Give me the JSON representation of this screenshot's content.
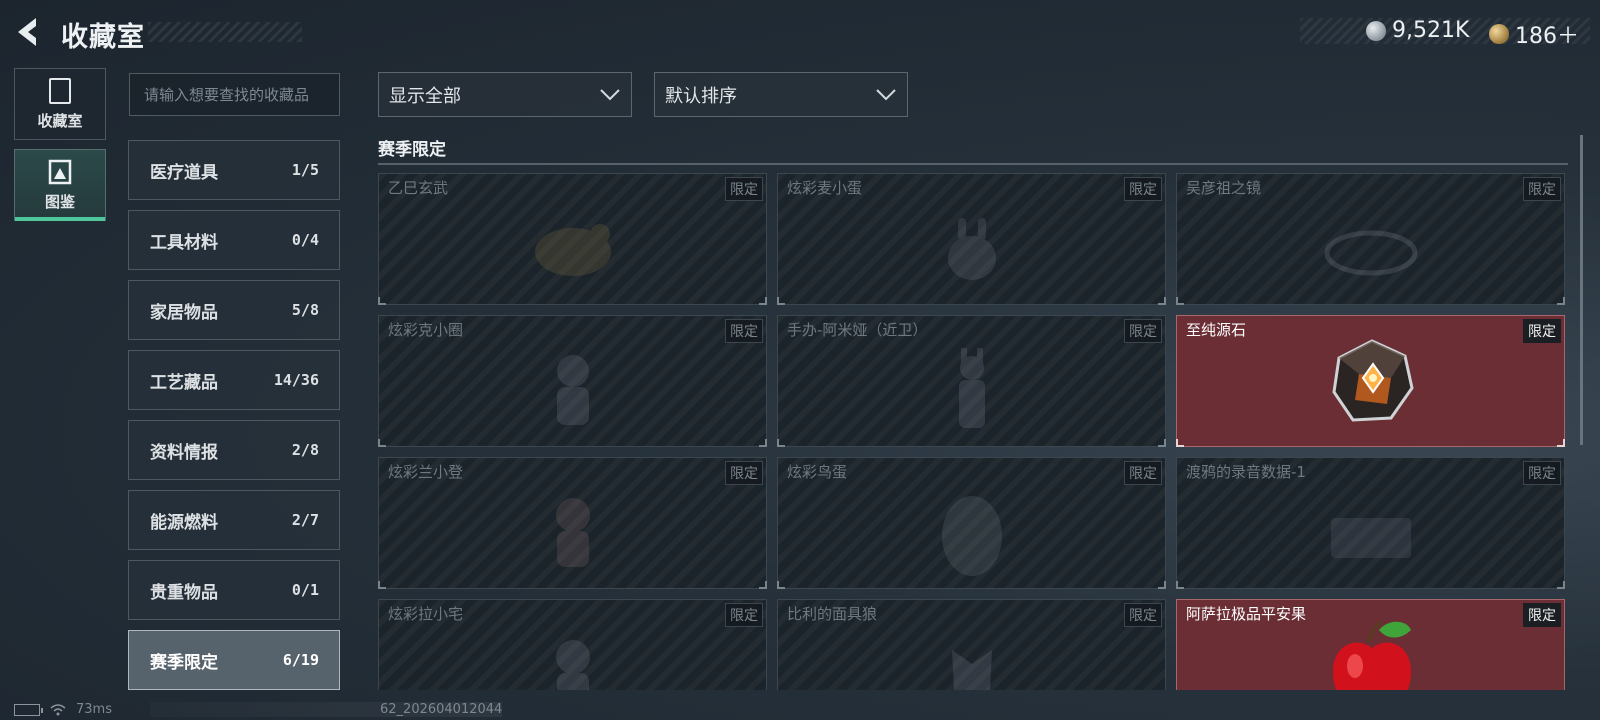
{
  "header": {
    "title": "收藏室"
  },
  "currency": {
    "silver": "9,521K",
    "gold": "186＋"
  },
  "rail": [
    {
      "label": "收藏室",
      "icon": "trophy-case-icon"
    },
    {
      "label": "图鉴",
      "icon": "codex-icon"
    }
  ],
  "search": {
    "placeholder": "请输入想要查找的收藏品"
  },
  "categories": [
    {
      "name": "医疗道具",
      "count": "1/5"
    },
    {
      "name": "工具材料",
      "count": "0/4"
    },
    {
      "name": "家居物品",
      "count": "5/8"
    },
    {
      "name": "工艺藏品",
      "count": "14/36"
    },
    {
      "name": "资料情报",
      "count": "2/8"
    },
    {
      "name": "能源燃料",
      "count": "2/7"
    },
    {
      "name": "贵重物品",
      "count": "0/1"
    },
    {
      "name": "赛季限定",
      "count": "6/19"
    }
  ],
  "filters": {
    "show": "显示全部",
    "sort": "默认排序"
  },
  "section": {
    "title": "赛季限定"
  },
  "items": [
    {
      "name": "乙巳玄武",
      "tag": "限定",
      "owned": false
    },
    {
      "name": "炫彩麦小蛋",
      "tag": "限定",
      "owned": false
    },
    {
      "name": "吴彦祖之镜",
      "tag": "限定",
      "owned": false
    },
    {
      "name": "炫彩克小圈",
      "tag": "限定",
      "owned": false
    },
    {
      "name": "手办-阿米娅（近卫）",
      "tag": "限定",
      "owned": false
    },
    {
      "name": "至纯源石",
      "tag": "限定",
      "owned": true
    },
    {
      "name": "炫彩兰小登",
      "tag": "限定",
      "owned": false
    },
    {
      "name": "炫彩鸟蛋",
      "tag": "限定",
      "owned": false
    },
    {
      "name": "渡鸦的录音数据-1",
      "tag": "限定",
      "owned": false
    },
    {
      "name": "炫彩拉小宅",
      "tag": "限定",
      "owned": false
    },
    {
      "name": "比利的面具狼",
      "tag": "限定",
      "owned": false
    },
    {
      "name": "阿萨拉极品平安果",
      "tag": "限定",
      "owned": true
    }
  ],
  "status": {
    "ping": "73ms",
    "build": "62_202604012044"
  },
  "colors": {
    "accent": "#4fc69b",
    "owned_card": "#6b2e35"
  }
}
